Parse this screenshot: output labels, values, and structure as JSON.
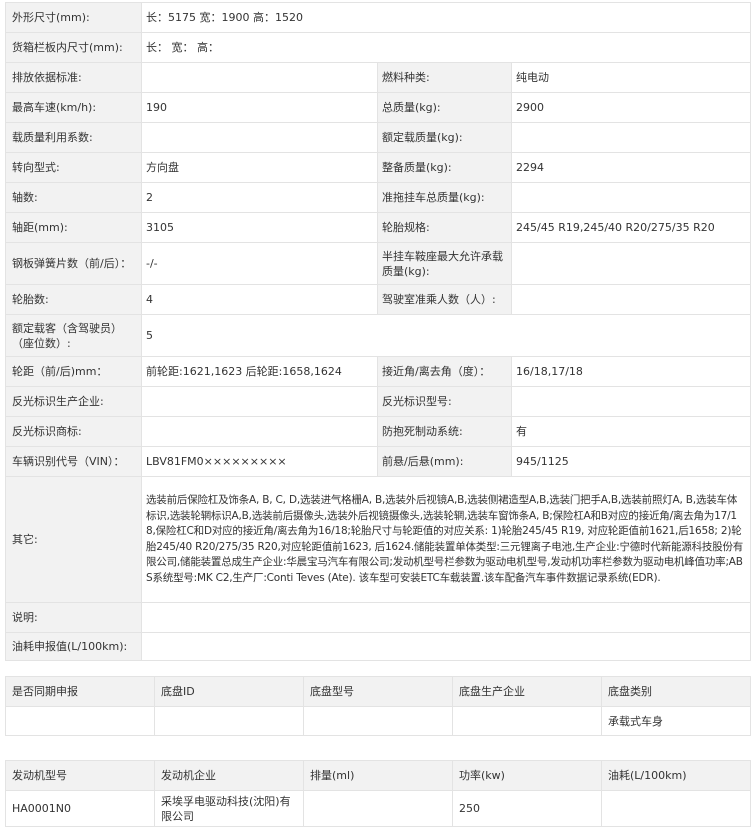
{
  "specs": {
    "dimensions": {
      "label": "外形尺寸(mm):",
      "value": "长：5175 宽：1900 高：1520"
    },
    "cargo_dimensions": {
      "label": "货箱栏板内尺寸(mm):",
      "value": "长： 宽： 高："
    },
    "emission_standard": {
      "label": "排放依据标准:",
      "value": ""
    },
    "fuel_type": {
      "label": "燃料种类:",
      "value": "纯电动"
    },
    "max_speed": {
      "label": "最高车速(km/h):",
      "value": "190"
    },
    "total_mass": {
      "label": "总质量(kg):",
      "value": "2900"
    },
    "load_utilization": {
      "label": "载质量利用系数:",
      "value": ""
    },
    "rated_load": {
      "label": "额定载质量(kg):",
      "value": ""
    },
    "steering": {
      "label": "转向型式:",
      "value": "方向盘"
    },
    "curb_weight": {
      "label": "整备质量(kg):",
      "value": "2294"
    },
    "axles": {
      "label": "轴数:",
      "value": "2"
    },
    "trailer_mass": {
      "label": "准拖挂车总质量(kg):",
      "value": ""
    },
    "wheelbase": {
      "label": "轴距(mm):",
      "value": "3105"
    },
    "tire_spec": {
      "label": "轮胎规格:",
      "value": "245/45 R19,245/40 R20/275/35 R20"
    },
    "leaf_springs": {
      "label": "钢板弹簧片数（前/后）：",
      "value": "-/-"
    },
    "saddle_load": {
      "label": "半挂车鞍座最大允许承载质量(kg):",
      "value": ""
    },
    "tire_count": {
      "label": "轮胎数:",
      "value": "4"
    },
    "cab_passengers": {
      "label": "驾驶室准乘人数（人）:",
      "value": ""
    },
    "rated_passengers": {
      "label": "额定载客（含驾驶员）（座位数）:",
      "value": "5"
    },
    "track": {
      "label": "轮距（前/后)mm：",
      "value": "前轮距:1621,1623 后轮距:1658,1624"
    },
    "approach_departure": {
      "label": "接近角/离去角（度）：",
      "value": "16/18,17/18"
    },
    "reflector_maker": {
      "label": "反光标识生产企业:",
      "value": ""
    },
    "reflector_model": {
      "label": "反光标识型号:",
      "value": ""
    },
    "reflector_brand": {
      "label": "反光标识商标:",
      "value": ""
    },
    "abs": {
      "label": "防抱死制动系统:",
      "value": "有"
    },
    "vin": {
      "label": "车辆识别代号（VIN）：",
      "value": "LBV81FM0×××××××××"
    },
    "overhang": {
      "label": "前悬/后悬(mm):",
      "value": "945/1125"
    },
    "other": {
      "label": "其它:",
      "value": "选装前后保险杠及饰条A, B, C, D,选装进气格栅A, B,选装外后视镜A,B,选装侧裙造型A,B,选装门把手A,B,选装前照灯A, B,选装车体标识,选装轮辋标识A,B,选装前后摄像头,选装外后视镜摄像头,选装轮辋,选装车窗饰条A, B;保险杠A和B对应的接近角/离去角为17/18,保险杠C和D对应的接近角/离去角为16/18;轮胎尺寸与轮距值的对应关系: 1)轮胎245/45 R19, 对应轮距值前1621,后1658; 2)轮胎245/40 R20/275/35 R20,对应轮距值前1623, 后1624.储能装置单体类型:三元锂离子电池,生产企业:宁德时代新能源科技股份有限公司,储能装置总成生产企业:华晨宝马汽车有限公司;发动机型号栏参数为驱动电机型号,发动机功率栏参数为驱动电机峰值功率;ABS系统型号:MK C2,生产厂:Conti Teves (Ate). 该车型可安装ETC车载装置.该车配备汽车事件数据记录系统(EDR)."
    },
    "note": {
      "label": "说明:",
      "value": ""
    },
    "fuel_consumption": {
      "label": "油耗申报值(L/100km):",
      "value": ""
    }
  },
  "chassis": {
    "headers": [
      "是否同期申报",
      "底盘ID",
      "底盘型号",
      "底盘生产企业",
      "底盘类别"
    ],
    "row": [
      "",
      "",
      "",
      "",
      "承载式车身"
    ]
  },
  "engine": {
    "headers": [
      "发动机型号",
      "发动机企业",
      "排量(ml)",
      "功率(kw)",
      "油耗(L/100km)"
    ],
    "row": [
      "HA0001N0",
      "采埃孚电驱动科技(沈阳)有限公司",
      "",
      "250",
      ""
    ]
  }
}
